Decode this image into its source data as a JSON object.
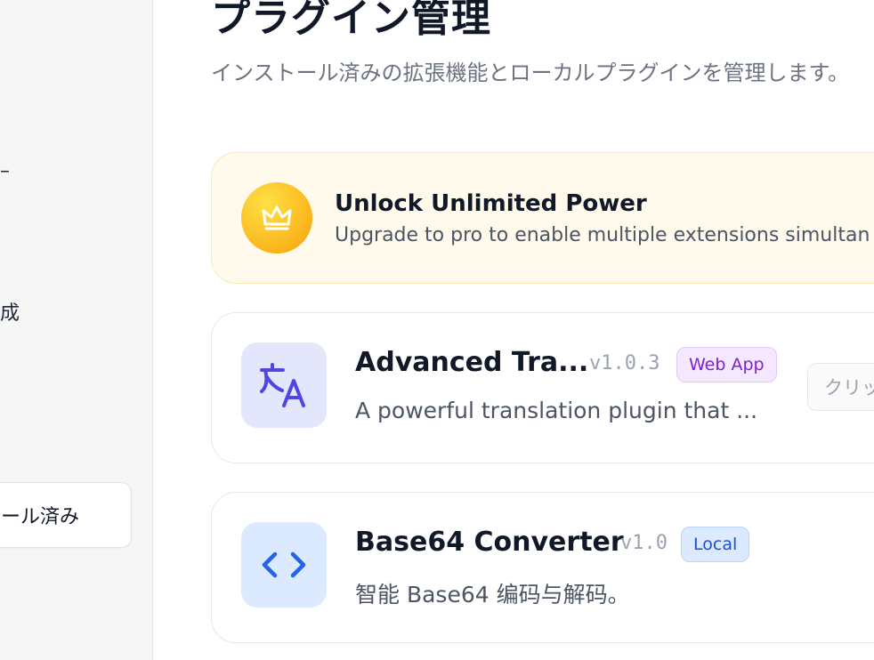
{
  "sidebar": {
    "fragment_1": "–",
    "fragment_2": "成",
    "active_item_label": "ール済み"
  },
  "page": {
    "title": "プラグイン管理",
    "description": "インストール済みの拡張機能とローカルプラグインを管理します。"
  },
  "promo": {
    "title": "Unlock Unlimited Power",
    "subtitle": "Upgrade to pro to enable multiple extensions simultan",
    "icon": "crown-icon",
    "colors": {
      "background": "#fffaeb",
      "badge": "#fbbf24"
    }
  },
  "plugins": [
    {
      "name": "Advanced Tra...",
      "version": "v1.0.3",
      "badge": "Web App",
      "description": "A powerful translation plugin that ...",
      "icon": "translate-icon",
      "action_label": "クリッ"
    },
    {
      "name": "Base64 Converter",
      "version": "v1.0",
      "badge": "Local",
      "description": "智能 Base64 编码与解码。",
      "icon": "code-brackets-icon"
    }
  ]
}
